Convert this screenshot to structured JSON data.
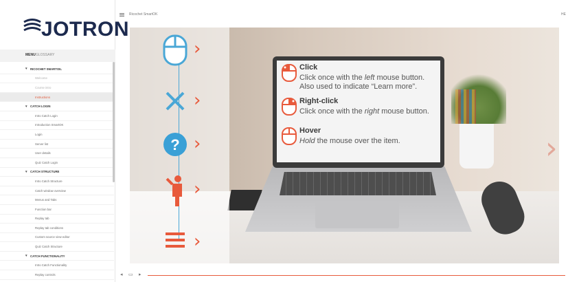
{
  "app": {
    "logo_text": "JOTRON",
    "title": "Ricochet SmartOK",
    "topbar_right": "HE"
  },
  "sidebar": {
    "tab_menu": "MENU",
    "tab_glossary": "GLOSSARY",
    "items": [
      {
        "label": "RICOCHET SMARTOIL",
        "type": "section"
      },
      {
        "label": "Welcome",
        "type": "item",
        "state": "dim"
      },
      {
        "label": "Course intro",
        "type": "item",
        "state": "dim"
      },
      {
        "label": "Instructions",
        "type": "item",
        "state": "active"
      },
      {
        "label": "CATCH LOGIN",
        "type": "section"
      },
      {
        "label": "Intro Catch Login",
        "type": "item"
      },
      {
        "label": "Introduction SmartOK",
        "type": "item"
      },
      {
        "label": "Login",
        "type": "item"
      },
      {
        "label": "Server list",
        "type": "item"
      },
      {
        "label": "User details",
        "type": "item"
      },
      {
        "label": "Quiz Catch Login",
        "type": "item"
      },
      {
        "label": "CATCH STRUCTURE",
        "type": "section"
      },
      {
        "label": "Intro Catch Structure",
        "type": "item"
      },
      {
        "label": "Catch window overview",
        "type": "item"
      },
      {
        "label": "Menus and Tabs",
        "type": "item"
      },
      {
        "label": "Function bar",
        "type": "item"
      },
      {
        "label": "Replay tab",
        "type": "item"
      },
      {
        "label": "Replay tab conditions",
        "type": "item"
      },
      {
        "label": "Custom source view editor",
        "type": "item"
      },
      {
        "label": "Quiz Catch Structure",
        "type": "item"
      },
      {
        "label": "CATCH FUNCTIONALITY",
        "type": "section"
      },
      {
        "label": "Intro Catch Functionality",
        "type": "item"
      },
      {
        "label": "Replay controls",
        "type": "item"
      }
    ]
  },
  "slide": {
    "left_icons": [
      "mouse-icon",
      "close-icon",
      "help-icon",
      "person-pointing-icon",
      "menu-icon"
    ],
    "help": [
      {
        "title": "Click",
        "lines": [
          "Click once with the left mouse button.",
          "Also used to indicate “Learn more”."
        ],
        "icon": "mouse-left-click-icon"
      },
      {
        "title": "Right-click",
        "lines": [
          "Click once with the right mouse button."
        ],
        "icon": "mouse-right-click-icon"
      },
      {
        "title": "Hover",
        "lines": [
          "Hold the mouse over the item."
        ],
        "icon": "mouse-hover-icon"
      }
    ],
    "accent_color": "#e85a3c",
    "line_color": "#4aa7d6"
  },
  "player": {
    "rewind_icon": "rewind-icon",
    "cc_icon": "captions-icon",
    "play_icon": "play-icon"
  }
}
